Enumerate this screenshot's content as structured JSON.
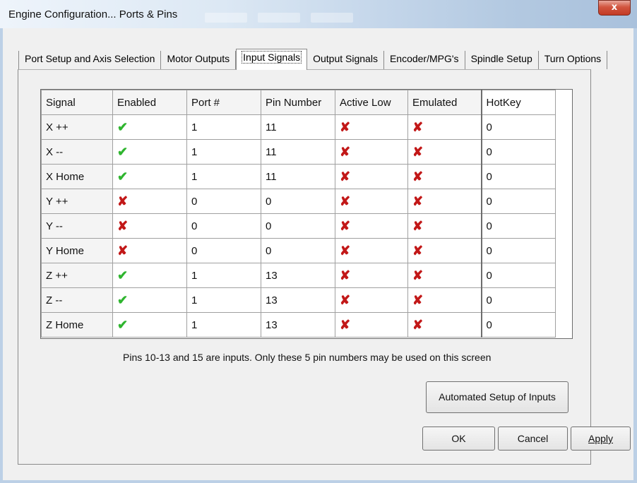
{
  "window": {
    "title": "Engine Configuration... Ports & Pins",
    "close_label": "x"
  },
  "tabs": [
    {
      "label": "Port Setup and Axis Selection",
      "active": false
    },
    {
      "label": "Motor Outputs",
      "active": false
    },
    {
      "label": "Input Signals",
      "active": true
    },
    {
      "label": "Output Signals",
      "active": false
    },
    {
      "label": "Encoder/MPG's",
      "active": false
    },
    {
      "label": "Spindle Setup",
      "active": false
    },
    {
      "label": "Turn Options",
      "active": false
    }
  ],
  "grid": {
    "columns": [
      "Signal",
      "Enabled",
      "Port #",
      "Pin Number",
      "Active Low",
      "Emulated",
      "HotKey"
    ],
    "rows": [
      {
        "signal": "X ++",
        "enabled": "yes",
        "port": "1",
        "pin": "11",
        "active_low": "no",
        "emulated": "no",
        "hotkey": "0"
      },
      {
        "signal": "X --",
        "enabled": "yes",
        "port": "1",
        "pin": "11",
        "active_low": "no",
        "emulated": "no",
        "hotkey": "0"
      },
      {
        "signal": "X Home",
        "enabled": "yes",
        "port": "1",
        "pin": "11",
        "active_low": "no",
        "emulated": "no",
        "hotkey": "0"
      },
      {
        "signal": "Y ++",
        "enabled": "no",
        "port": "0",
        "pin": "0",
        "active_low": "no",
        "emulated": "no",
        "hotkey": "0"
      },
      {
        "signal": "Y --",
        "enabled": "no",
        "port": "0",
        "pin": "0",
        "active_low": "no",
        "emulated": "no",
        "hotkey": "0"
      },
      {
        "signal": "Y Home",
        "enabled": "no",
        "port": "0",
        "pin": "0",
        "active_low": "no",
        "emulated": "no",
        "hotkey": "0"
      },
      {
        "signal": "Z ++",
        "enabled": "yes",
        "port": "1",
        "pin": "13",
        "active_low": "no",
        "emulated": "no",
        "hotkey": "0"
      },
      {
        "signal": "Z --",
        "enabled": "yes",
        "port": "1",
        "pin": "13",
        "active_low": "no",
        "emulated": "no",
        "hotkey": "0"
      },
      {
        "signal": "Z Home",
        "enabled": "yes",
        "port": "1",
        "pin": "13",
        "active_low": "no",
        "emulated": "no",
        "hotkey": "0"
      }
    ]
  },
  "icons": {
    "check": {
      "name": "green-check-icon",
      "glyph": "✔",
      "color": "#2fb52f"
    },
    "cross": {
      "name": "red-x-icon",
      "glyph": "✘",
      "color": "#c21818"
    }
  },
  "info_text": "Pins 10-13 and 15 are inputs. Only these 5 pin numbers may be used on this screen",
  "buttons": {
    "automated_setup": "Automated Setup of Inputs",
    "ok": "OK",
    "cancel": "Cancel",
    "apply": "Apply"
  },
  "colors": {
    "titlebar_accent": "#a9c1dc",
    "close_button": "#c33b25"
  }
}
